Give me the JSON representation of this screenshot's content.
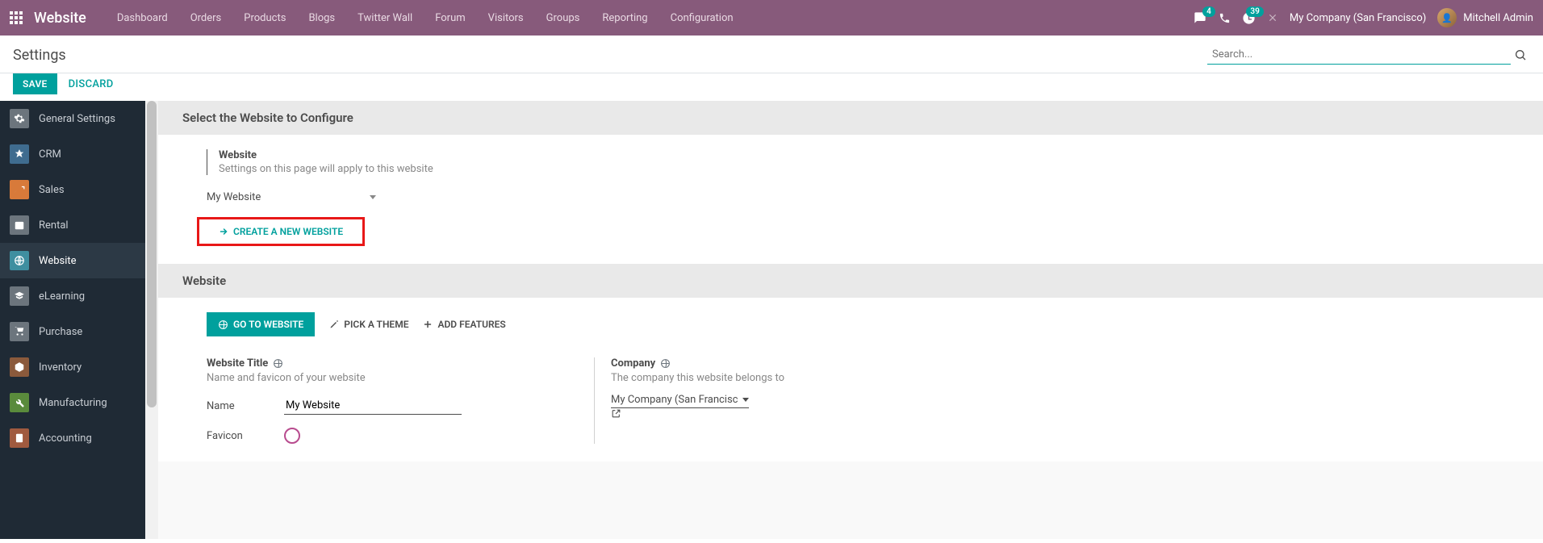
{
  "navbar": {
    "brand": "Website",
    "menu": [
      "Dashboard",
      "Orders",
      "Products",
      "Blogs",
      "Twitter Wall",
      "Forum",
      "Visitors",
      "Groups",
      "Reporting",
      "Configuration"
    ],
    "messages_badge": "4",
    "activities_badge": "39",
    "company": "My Company (San Francisco)",
    "user": "Mitchell Admin"
  },
  "control": {
    "title": "Settings",
    "search_placeholder": "Search...",
    "save": "SAVE",
    "discard": "DISCARD"
  },
  "sidebar": {
    "items": [
      {
        "label": "General Settings",
        "icon_bg": "#6c757d"
      },
      {
        "label": "CRM",
        "icon_bg": "#3f6c8f"
      },
      {
        "label": "Sales",
        "icon_bg": "#d87a3a"
      },
      {
        "label": "Rental",
        "icon_bg": "#6c757d"
      },
      {
        "label": "Website",
        "icon_bg": "#3f8fa0"
      },
      {
        "label": "eLearning",
        "icon_bg": "#6c757d"
      },
      {
        "label": "Purchase",
        "icon_bg": "#6c757d"
      },
      {
        "label": "Inventory",
        "icon_bg": "#8b5a3c"
      },
      {
        "label": "Manufacturing",
        "icon_bg": "#5a8b3c"
      },
      {
        "label": "Accounting",
        "icon_bg": "#a05a3f"
      }
    ],
    "active_index": 4
  },
  "sections": {
    "select_header": "Select the Website to Configure",
    "website_field_label": "Website",
    "website_field_desc": "Settings on this page will apply to this website",
    "website_selected": "My Website",
    "create_new": "CREATE A NEW WEBSITE",
    "website_header": "Website",
    "go_to_website": "GO TO WEBSITE",
    "pick_theme": "PICK A THEME",
    "add_features": "ADD FEATURES",
    "title_label": "Website Title",
    "title_desc": "Name and favicon of your website",
    "name_label": "Name",
    "name_value": "My Website",
    "favicon_label": "Favicon",
    "company_label": "Company",
    "company_desc": "The company this website belongs to",
    "company_value": "My Company (San Francisc"
  }
}
